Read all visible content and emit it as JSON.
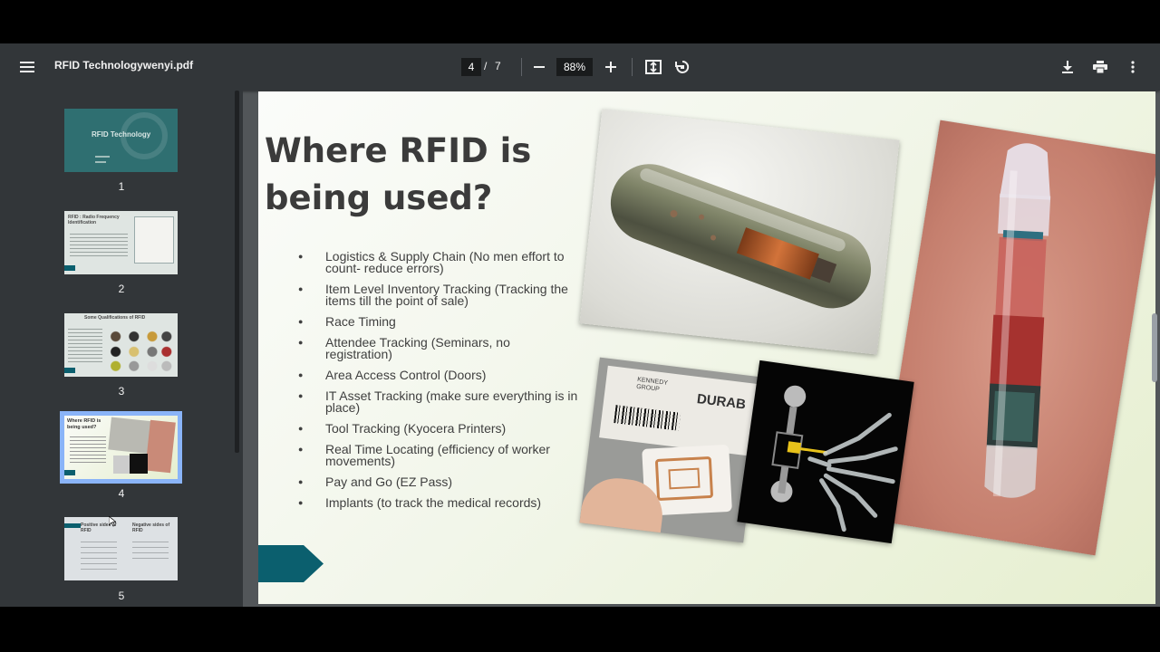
{
  "toolbar": {
    "file_name": "RFID Technologywenyi.pdf",
    "current_page": "4",
    "page_separator": "/",
    "total_pages": "7",
    "zoom": "88%"
  },
  "thumbnails": [
    {
      "num": "1",
      "title": "RFID Technology"
    },
    {
      "num": "2",
      "title": "RFID : Radio Frequency Identification"
    },
    {
      "num": "3",
      "title": "Some Qualifications of RFID"
    },
    {
      "num": "4",
      "title": "Where RFID is being used?"
    },
    {
      "num": "5",
      "title": "Positive sides of RFID",
      "title2": "Negative sides of RFID"
    }
  ],
  "slide": {
    "title": "Where RFID is being used?",
    "bullets": [
      "Logistics & Supply Chain (No men effort to count- reduce errors)",
      "Item Level Inventory Tracking (Tracking the items till the point of sale)",
      "Race Timing",
      "Attendee Tracking (Seminars, no registration)",
      "Area Access Control (Doors)",
      "IT Asset Tracking (make sure everything is in place)",
      "Tool Tracking (Kyocera Printers)",
      "Real Time Locating (efficiency of worker movements)",
      "Pay and Go (EZ Pass)",
      "Implants (to track the medical records)"
    ],
    "label_text": "KENNEDY GROUP",
    "label_text2": "DURAB"
  },
  "colors": {
    "toolbar_bg": "#323639",
    "viewer_bg": "#525659",
    "accent_chevron": "#0b5f6e",
    "selected_thumb": "#8ab4f8"
  },
  "icons": [
    "menu-icon",
    "zoom-out-icon",
    "zoom-in-icon",
    "fit-page-icon",
    "rotate-icon",
    "download-icon",
    "print-icon",
    "more-vert-icon"
  ]
}
